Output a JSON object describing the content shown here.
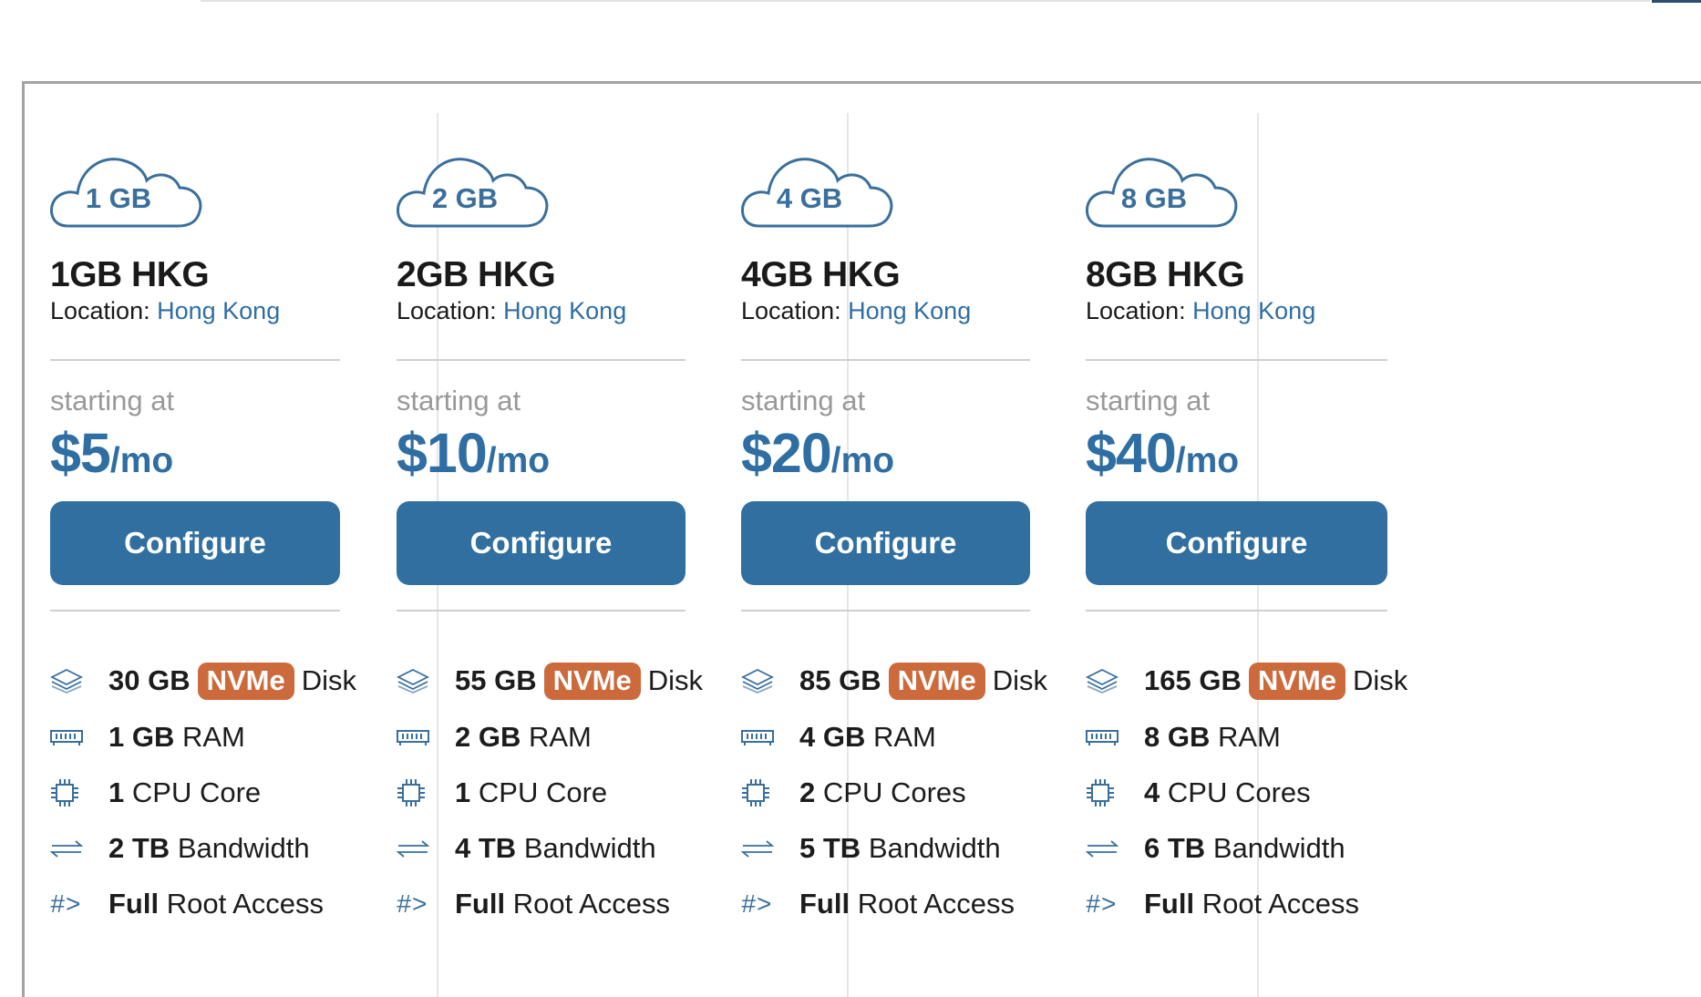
{
  "colors": {
    "accent": "#2f6ea3",
    "button": "#306fa0",
    "badge": "#cc6a3c",
    "muted": "#999999"
  },
  "plans": [
    {
      "badge": "1 GB",
      "name": "1GB HKG",
      "location_label": "Location:",
      "location": "Hong Kong",
      "starting_label": "starting at",
      "price": "$5",
      "per": "/mo",
      "configure_label": "Configure",
      "disk": {
        "size": "30 GB",
        "badge": "NVMe",
        "label": "Disk"
      },
      "ram": {
        "value": "1 GB",
        "label": "RAM"
      },
      "cpu": {
        "value": "1",
        "label": "CPU Core"
      },
      "bandwidth": {
        "value": "2 TB",
        "label": "Bandwidth"
      },
      "root": {
        "value": "Full",
        "label": "Root Access"
      }
    },
    {
      "badge": "2 GB",
      "name": "2GB HKG",
      "location_label": "Location:",
      "location": "Hong Kong",
      "starting_label": "starting at",
      "price": "$10",
      "per": "/mo",
      "configure_label": "Configure",
      "disk": {
        "size": "55 GB",
        "badge": "NVMe",
        "label": "Disk"
      },
      "ram": {
        "value": "2 GB",
        "label": "RAM"
      },
      "cpu": {
        "value": "1",
        "label": "CPU Core"
      },
      "bandwidth": {
        "value": "4 TB",
        "label": "Bandwidth"
      },
      "root": {
        "value": "Full",
        "label": "Root Access"
      }
    },
    {
      "badge": "4 GB",
      "name": "4GB HKG",
      "location_label": "Location:",
      "location": "Hong Kong",
      "starting_label": "starting at",
      "price": "$20",
      "per": "/mo",
      "configure_label": "Configure",
      "disk": {
        "size": "85 GB",
        "badge": "NVMe",
        "label": "Disk"
      },
      "ram": {
        "value": "4 GB",
        "label": "RAM"
      },
      "cpu": {
        "value": "2",
        "label": "CPU Cores"
      },
      "bandwidth": {
        "value": "5 TB",
        "label": "Bandwidth"
      },
      "root": {
        "value": "Full",
        "label": "Root Access"
      }
    },
    {
      "badge": "8 GB",
      "name": "8GB HKG",
      "location_label": "Location:",
      "location": "Hong Kong",
      "starting_label": "starting at",
      "price": "$40",
      "per": "/mo",
      "configure_label": "Configure",
      "disk": {
        "size": "165 GB",
        "badge": "NVMe",
        "label": "Disk"
      },
      "ram": {
        "value": "8 GB",
        "label": "RAM"
      },
      "cpu": {
        "value": "4",
        "label": "CPU Cores"
      },
      "bandwidth": {
        "value": "6 TB",
        "label": "Bandwidth"
      },
      "root": {
        "value": "Full",
        "label": "Root Access"
      }
    }
  ]
}
